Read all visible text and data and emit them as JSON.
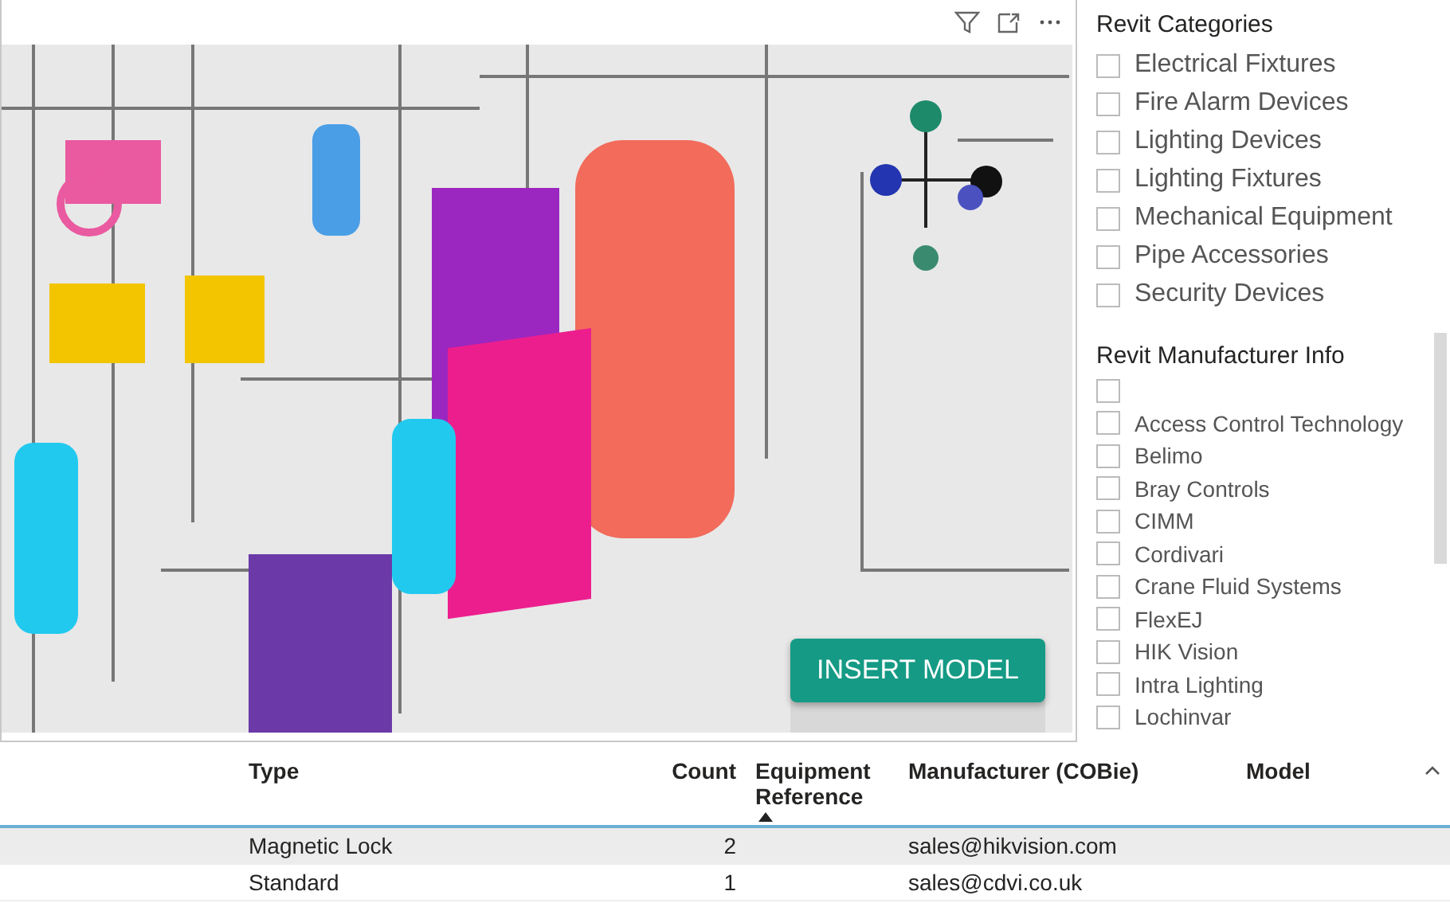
{
  "viewer": {
    "button": "INSERT MODEL"
  },
  "slicers": [
    {
      "title": "Revit Categories",
      "kind": "large",
      "items": [
        {
          "label": "Electrical Fixtures",
          "checked": false
        },
        {
          "label": "Fire Alarm Devices",
          "checked": false
        },
        {
          "label": "Lighting Devices",
          "checked": false
        },
        {
          "label": "Lighting Fixtures",
          "checked": false
        },
        {
          "label": "Mechanical Equipment",
          "checked": false
        },
        {
          "label": "Pipe Accessories",
          "checked": false
        },
        {
          "label": "Security Devices",
          "checked": false
        }
      ]
    },
    {
      "title": "Revit Manufacturer Info",
      "kind": "small",
      "items": [
        {
          "checked": false
        },
        {
          "label": "Access Control Technology",
          "checked": false
        },
        {
          "label": "Belimo",
          "checked": false
        },
        {
          "label": "Bray Controls",
          "checked": false
        },
        {
          "label": "CIMM",
          "checked": false
        },
        {
          "label": "Cordivari",
          "checked": false
        },
        {
          "label": "Crane Fluid Systems",
          "checked": false
        },
        {
          "label": "FlexEJ",
          "checked": false
        },
        {
          "label": "HIK Vision",
          "checked": false
        },
        {
          "label": "Intra Lighting",
          "checked": false
        },
        {
          "label": "Lochinvar",
          "checked": false
        }
      ]
    }
  ],
  "table": {
    "columns": [
      {
        "label": "Type",
        "kind": "text",
        "sorted": false
      },
      {
        "label": "Count",
        "kind": "number",
        "sorted": false
      },
      {
        "label": "Equipment Reference",
        "kind": "text",
        "sorted": true
      },
      {
        "label": "Manufacturer (COBie)",
        "kind": "text",
        "sorted": false
      },
      {
        "label": "Model",
        "kind": "text",
        "sorted": false
      }
    ],
    "rows": [
      {
        "selected": true,
        "cells": [
          "Magnetic Lock",
          "2",
          "",
          "sales@hikvision.com",
          ""
        ]
      },
      {
        "selected": false,
        "cells": [
          "Standard",
          "1",
          "",
          "sales@cdvi.co.uk",
          ""
        ]
      }
    ]
  }
}
